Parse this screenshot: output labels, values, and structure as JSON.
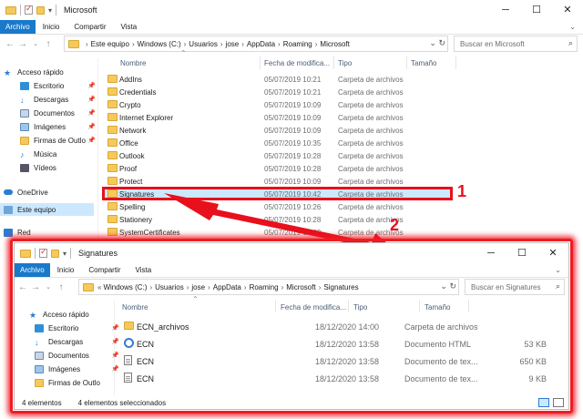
{
  "back": {
    "title": "Microsoft",
    "ribbon": {
      "file": "Archivo",
      "tabs": [
        "Inicio",
        "Compartir",
        "Vista"
      ]
    },
    "address": [
      "Este equipo",
      "Windows (C:)",
      "Usuarios",
      "jose",
      "AppData",
      "Roaming",
      "Microsoft"
    ],
    "search_placeholder": "Buscar en Microsoft",
    "nav": [
      {
        "label": "Acceso rápido",
        "icon": "star-icon"
      },
      {
        "label": "Escritorio",
        "icon": "desktop-icon"
      },
      {
        "label": "Descargas",
        "icon": "download-icon"
      },
      {
        "label": "Documentos",
        "icon": "documents-icon"
      },
      {
        "label": "Imágenes",
        "icon": "pictures-icon"
      },
      {
        "label": "Firmas de Outlo",
        "icon": "folder-icon"
      },
      {
        "label": "Música",
        "icon": "music-icon"
      },
      {
        "label": "Vídeos",
        "icon": "videos-icon"
      },
      {
        "label": "OneDrive",
        "icon": "cloud-icon"
      },
      {
        "label": "Este equipo",
        "icon": "computer-icon"
      },
      {
        "label": "Red",
        "icon": "network-icon"
      }
    ],
    "columns": {
      "name": "Nombre",
      "date": "Fecha de modifica...",
      "type": "Tipo",
      "size": "Tamaño"
    },
    "rows": [
      {
        "name": "AddIns",
        "date": "05/07/2019 10:21",
        "type": "Carpeta de archivos"
      },
      {
        "name": "Credentials",
        "date": "05/07/2019 10:21",
        "type": "Carpeta de archivos"
      },
      {
        "name": "Crypto",
        "date": "05/07/2019 10:09",
        "type": "Carpeta de archivos"
      },
      {
        "name": "Internet Explorer",
        "date": "05/07/2019 10:09",
        "type": "Carpeta de archivos"
      },
      {
        "name": "Network",
        "date": "05/07/2019 10:09",
        "type": "Carpeta de archivos"
      },
      {
        "name": "Office",
        "date": "05/07/2019 10:35",
        "type": "Carpeta de archivos"
      },
      {
        "name": "Outlook",
        "date": "05/07/2019 10:28",
        "type": "Carpeta de archivos"
      },
      {
        "name": "Proof",
        "date": "05/07/2019 10:28",
        "type": "Carpeta de archivos"
      },
      {
        "name": "Protect",
        "date": "05/07/2019 10:09",
        "type": "Carpeta de archivos"
      },
      {
        "name": "Signatures",
        "date": "05/07/2019 10:42",
        "type": "Carpeta de archivos"
      },
      {
        "name": "Spelling",
        "date": "05/07/2019 10:26",
        "type": "Carpeta de archivos"
      },
      {
        "name": "Stationery",
        "date": "05/07/2019 10:28",
        "type": "Carpeta de archivos"
      },
      {
        "name": "SystemCertificates",
        "date": "05/07/2019 10:09",
        "type": "Carpeta de archivos"
      }
    ]
  },
  "front": {
    "title": "Signatures",
    "ribbon": {
      "file": "Archivo",
      "tabs": [
        "Inicio",
        "Compartir",
        "Vista"
      ]
    },
    "address_prefix": "«",
    "address": [
      "Windows (C:)",
      "Usuarios",
      "jose",
      "AppData",
      "Roaming",
      "Microsoft",
      "Signatures"
    ],
    "search_placeholder": "Buscar en Signatures",
    "nav": [
      {
        "label": "Acceso rápido",
        "icon": "star-icon"
      },
      {
        "label": "Escritorio",
        "icon": "desktop-icon"
      },
      {
        "label": "Descargas",
        "icon": "download-icon"
      },
      {
        "label": "Documentos",
        "icon": "documents-icon"
      },
      {
        "label": "Imágenes",
        "icon": "pictures-icon"
      },
      {
        "label": "Firmas de Outlo",
        "icon": "folder-icon"
      }
    ],
    "columns": {
      "name": "Nombre",
      "date": "Fecha de modifica...",
      "type": "Tipo",
      "size": "Tamaño"
    },
    "rows": [
      {
        "name": "ECN_archivos",
        "date": "18/12/2020 14:00",
        "type": "Carpeta de archivos",
        "size": "",
        "icon": "folder-icon"
      },
      {
        "name": "ECN",
        "date": "18/12/2020 13:58",
        "type": "Documento HTML",
        "size": "53 KB",
        "icon": "chrome-icon"
      },
      {
        "name": "ECN",
        "date": "18/12/2020 13:58",
        "type": "Documento de tex...",
        "size": "650 KB",
        "icon": "document-icon"
      },
      {
        "name": "ECN",
        "date": "18/12/2020 13:58",
        "type": "Documento de tex...",
        "size": "9 KB",
        "icon": "document-icon"
      }
    ],
    "status": {
      "count": "4 elementos",
      "selected": "4 elementos seleccionados"
    }
  },
  "annotations": {
    "one": "1",
    "two": "2"
  },
  "colors": {
    "accent": "#1979ca",
    "highlight": "#e8101c",
    "folder": "#f6c95c",
    "selection": "#cce8ff"
  }
}
